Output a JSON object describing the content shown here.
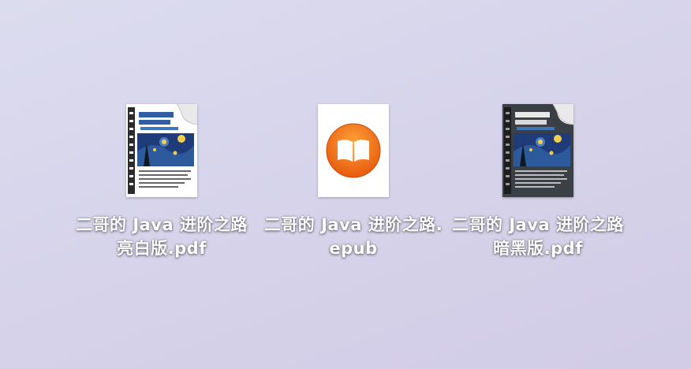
{
  "files": [
    {
      "label": "二哥的 Java 进阶之路亮白版.pdf",
      "icon": "pdf-light-cover-icon"
    },
    {
      "label": "二哥的 Java 进阶之路.epub",
      "icon": "books-app-icon"
    },
    {
      "label": "二哥的 Java 进阶之路暗黑版.pdf",
      "icon": "pdf-dark-cover-icon"
    }
  ],
  "colors": {
    "books_orange": "#f26a0f",
    "books_orange_light": "#ffa23a",
    "cover_blue": "#2f5ea3",
    "night_blue": "#1f3b7a",
    "star_yellow": "#f1cf4b"
  }
}
